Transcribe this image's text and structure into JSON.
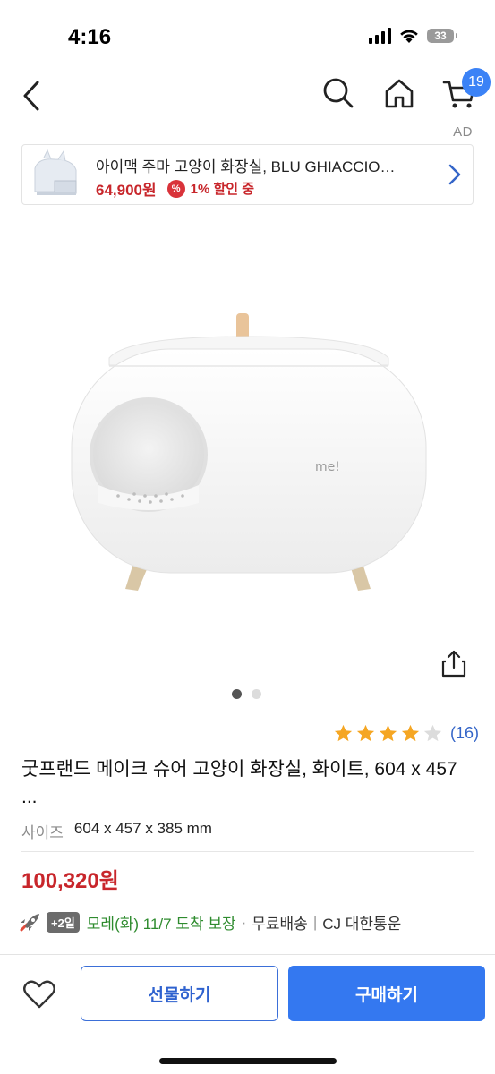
{
  "status_bar": {
    "time": "4:16",
    "battery": "33"
  },
  "nav": {
    "cart_count": "19"
  },
  "ad": {
    "label": "AD",
    "title": "아이맥 주마 고양이 화장실, BLU GHIACCIO…",
    "price": "64,900원",
    "discount_icon": "%",
    "discount": "1% 할인 중"
  },
  "gallery": {
    "current": 1,
    "total": 2
  },
  "rating": {
    "stars": 4,
    "max": 5,
    "count": "(16)"
  },
  "product": {
    "title": "굿프랜드 메이크 슈어 고양이 화장실, 화이트, 604 x 457 ...",
    "size_label": "사이즈",
    "size_value": "604 x 457 x 385 mm",
    "price": "100,320원",
    "logo": "me!"
  },
  "delivery": {
    "badge": "+2일",
    "arrival": "모레(화) 11/7 도착 보장",
    "dot": "·",
    "shipping": "무료배송",
    "separator": "|",
    "courier": "CJ 대한통운"
  },
  "actions": {
    "gift": "선물하기",
    "buy": "구매하기"
  },
  "colors": {
    "accent": "#3478f0",
    "price": "#c8262b",
    "arrival": "#2e8b2e",
    "star": "#f5a623"
  },
  "icons": [
    "back-icon",
    "search-icon",
    "home-icon",
    "cart-icon",
    "chevron-right-icon",
    "share-icon",
    "star-icon",
    "rocket-icon",
    "heart-icon"
  ]
}
